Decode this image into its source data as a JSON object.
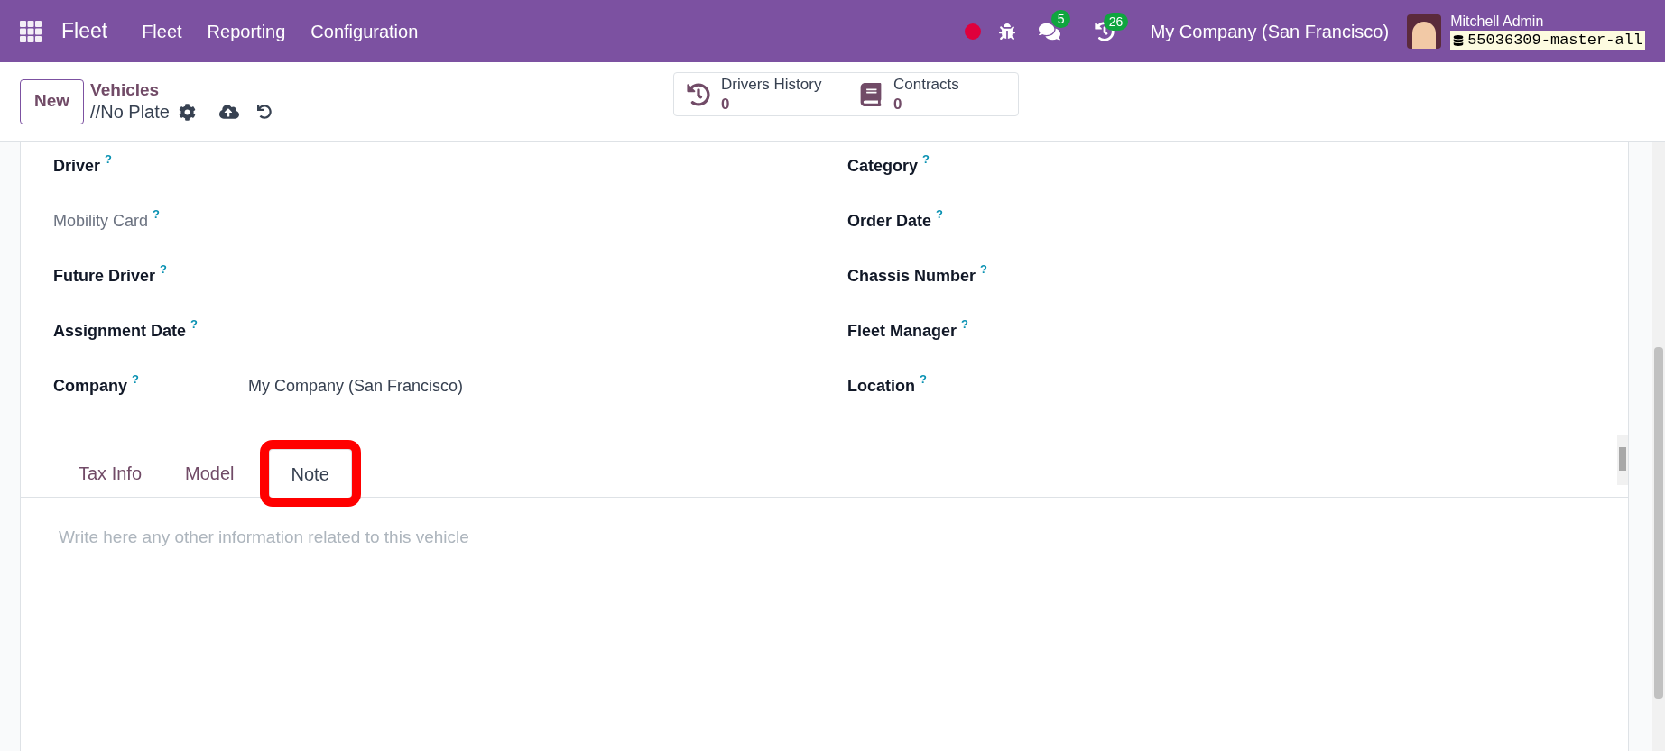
{
  "navbar": {
    "app_name": "Fleet",
    "menu": [
      "Fleet",
      "Reporting",
      "Configuration"
    ],
    "messages_count": "5",
    "activities_count": "26",
    "company": "My Company (San Francisco)",
    "user_name": "Mitchell Admin",
    "database": "55036309-master-all"
  },
  "control_panel": {
    "new_button": "New",
    "breadcrumb": "Vehicles",
    "record_name": "//No Plate",
    "smart_buttons": [
      {
        "kind": "history",
        "label": "Drivers History",
        "count": "0"
      },
      {
        "kind": "contracts",
        "label": "Contracts",
        "count": "0"
      }
    ]
  },
  "fields_left": [
    {
      "label": "Driver",
      "help": "?",
      "muted": false
    },
    {
      "label": "Mobility Card",
      "help": "?",
      "muted": true
    },
    {
      "label": "Future Driver",
      "help": "?",
      "muted": false
    },
    {
      "label": "Assignment Date",
      "help": "?",
      "muted": false
    },
    {
      "label": "Company",
      "help": "?",
      "muted": false,
      "value": "My Company (San Francisco)"
    }
  ],
  "fields_right": [
    {
      "label": "Category",
      "help": "?",
      "muted": false
    },
    {
      "label": "Order Date",
      "help": "?",
      "muted": false
    },
    {
      "label": "Chassis Number",
      "help": "?",
      "muted": false
    },
    {
      "label": "Fleet Manager",
      "help": "?",
      "muted": false
    },
    {
      "label": "Location",
      "help": "?",
      "muted": false
    }
  ],
  "tabs": [
    {
      "label": "Tax Info",
      "selected": false,
      "highlighted": false
    },
    {
      "label": "Model",
      "selected": false,
      "highlighted": false
    },
    {
      "label": "Note",
      "selected": true,
      "highlighted": true
    }
  ],
  "note": {
    "placeholder": "Write here any other information related to this vehicle"
  }
}
